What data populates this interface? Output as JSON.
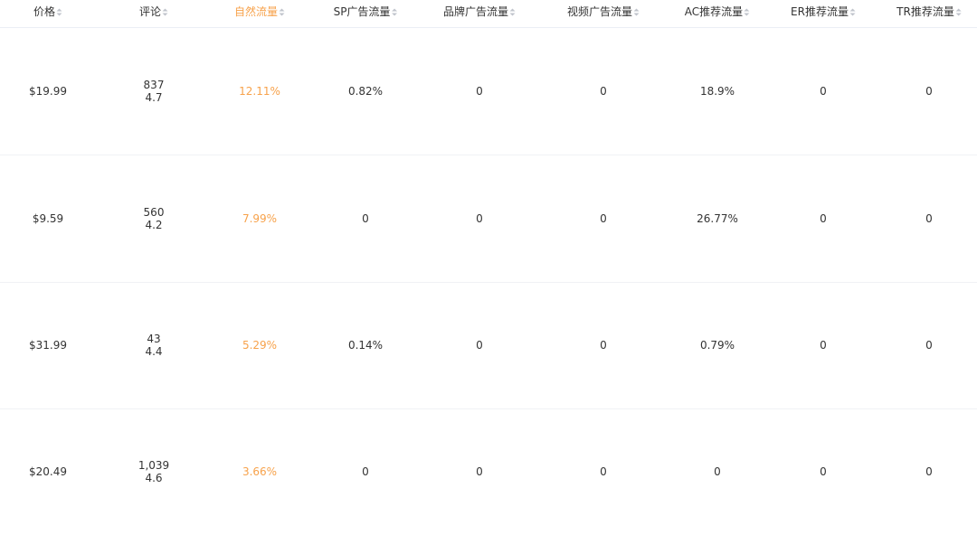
{
  "colors": {
    "accent": "#f7a24b",
    "text": "#333333",
    "sort_icon": "#c0c4cc",
    "divider": "#f0f2f5"
  },
  "columns": [
    {
      "key": "price",
      "label": "价格",
      "icon": "sort-icon"
    },
    {
      "key": "reviews",
      "label": "评论",
      "icon": "sort-icon"
    },
    {
      "key": "organic",
      "label": "自然流量",
      "icon": "sort-icon",
      "active": true
    },
    {
      "key": "sp_ads",
      "label": "SP广告流量",
      "icon": "sort-icon"
    },
    {
      "key": "brand_ads",
      "label": "品牌广告流量",
      "icon": "sort-icon"
    },
    {
      "key": "video_ads",
      "label": "视频广告流量",
      "icon": "sort-icon"
    },
    {
      "key": "ac",
      "label": "AC推荐流量",
      "icon": "sort-icon"
    },
    {
      "key": "er",
      "label": "ER推荐流量",
      "icon": "sort-icon"
    },
    {
      "key": "tr",
      "label": "TR推荐流量",
      "icon": "sort-icon"
    }
  ],
  "rows": [
    {
      "price": "$19.99",
      "review_count": "837",
      "rating": "4.7",
      "organic": "12.11%",
      "sp_ads": "0.82%",
      "brand_ads": "0",
      "video_ads": "0",
      "ac": "18.9%",
      "er": "0",
      "tr": "0"
    },
    {
      "price": "$9.59",
      "review_count": "560",
      "rating": "4.2",
      "organic": "7.99%",
      "sp_ads": "0",
      "brand_ads": "0",
      "video_ads": "0",
      "ac": "26.77%",
      "er": "0",
      "tr": "0"
    },
    {
      "price": "$31.99",
      "review_count": "43",
      "rating": "4.4",
      "organic": "5.29%",
      "sp_ads": "0.14%",
      "brand_ads": "0",
      "video_ads": "0",
      "ac": "0.79%",
      "er": "0",
      "tr": "0"
    },
    {
      "price": "$20.49",
      "review_count": "1,039",
      "rating": "4.6",
      "organic": "3.66%",
      "sp_ads": "0",
      "brand_ads": "0",
      "video_ads": "0",
      "ac": "0",
      "er": "0",
      "tr": "0"
    }
  ]
}
